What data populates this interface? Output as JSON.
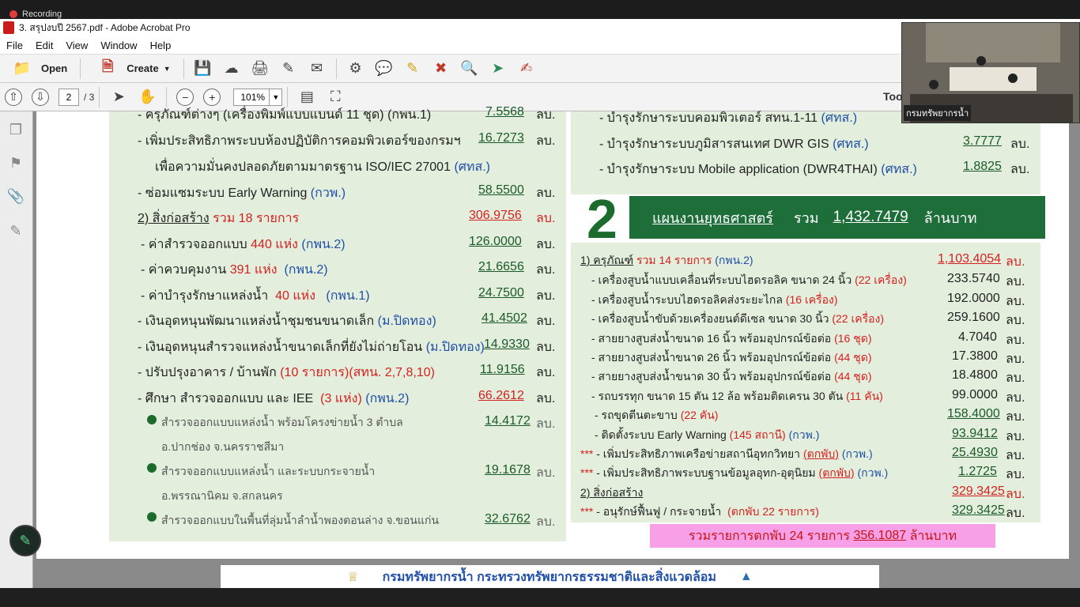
{
  "recording": {
    "label": "Recording"
  },
  "window": {
    "title": "3. สรุปงบปี 2567.pdf - Adobe Acrobat Pro"
  },
  "menu": [
    "File",
    "Edit",
    "View",
    "Window",
    "Help"
  ],
  "toolbar": {
    "open": "Open",
    "create": "Create",
    "tools": "Too"
  },
  "nav": {
    "page": "2",
    "total": "/ 3",
    "zoom": "101%"
  },
  "webcam": {
    "label": "กรมทรัพยากรน้ำ"
  },
  "left": {
    "l0": {
      "text": "- ครุภัณฑ์ต่างๆ (เครื่องพิมพ์แบบแบนด์ 11 ชุด) (กพน.1)",
      "num": "7.5568",
      "unit": "ลบ."
    },
    "l1": {
      "text": "- เพิ่มประสิทธิภาพระบบห้องปฏิบัติการคอมพิวเตอร์ของกรมฯ",
      "num": "16.7273",
      "unit": "ลบ."
    },
    "l1b": {
      "text": "เพื่อความมั่นคงปลอดภัยตามมาตรฐาน ISO/IEC 27001",
      "tag": "(ศทส.)"
    },
    "l2": {
      "text": "- ซ่อมแซมระบบ Early Warning",
      "tag": "(กวพ.)",
      "num": "58.5500",
      "unit": "ลบ."
    },
    "l3": {
      "text": "2) สิ่งก่อสร้าง",
      "red": "รวม 18 รายการ",
      "num": "306.9756",
      "unit": "ลบ."
    },
    "l4": {
      "text": "- ค่าสำรวจออกแบบ",
      "red": "440 แห่ง",
      "tag": "(กพน.2)",
      "num": "126.0000",
      "unit": "ลบ."
    },
    "l5": {
      "text": "- ค่าควบคุมงาน",
      "red": "391 แห่ง",
      "tag": "(กพน.2)",
      "num": "21.6656",
      "unit": "ลบ."
    },
    "l6": {
      "text": "- ค่าบำรุงรักษาแหล่งน้ำ",
      "red": "40 แห่ง",
      "tag": "(กพน.1)",
      "num": "24.7500",
      "unit": "ลบ."
    },
    "l7": {
      "text": "- เงินอุดหนุนพัฒนาแหล่งน้ำชุมชนขนาดเล็ก",
      "tag": "(ม.ปิดทอง)",
      "num": "41.4502",
      "unit": "ลบ."
    },
    "l8": {
      "text": "- เงินอุดหนุนสำรวจแหล่งน้ำขนาดเล็กที่ยังไม่ถ่ายโอน",
      "tag": "(ม.ปิดทอง)",
      "num": "14.9330",
      "unit": "ลบ."
    },
    "l9": {
      "text": "- ปรับปรุงอาคาร / บ้านพัก",
      "red": "(10 รายการ)(สทน. 2,7,8,10)",
      "num": "11.9156",
      "unit": "ลบ."
    },
    "l10": {
      "text": "- ศึกษา สำรวจออกแบบ และ IEE",
      "red": "(3 แห่ง)",
      "tag": "(กพน.2)",
      "num": "66.2612",
      "unit": "ลบ."
    },
    "b1": {
      "text": "สำรวจออกแบบแหล่งน้ำ พร้อมโครงข่ายน้ำ 3 ตำบล",
      "text2": "อ.ปากช่อง จ.นครราชสีมา",
      "num": "14.4172",
      "unit": "ลบ."
    },
    "b2": {
      "text": "สำรวจออกแบบแหล่งน้ำ และระบบกระจายน้ำ",
      "text2": "อ.พรรณานิคม จ.สกลนคร",
      "num": "19.1678",
      "unit": "ลบ."
    },
    "b3": {
      "text": "สำรวจออกแบบในพื้นที่ลุ่มน้ำลำน้ำพองตอนล่าง จ.ขอนแก่น",
      "num": "32.6762",
      "unit": "ลบ."
    }
  },
  "right_top": {
    "r0": {
      "text": "- บำรุงรักษาระบบคอมพิวเตอร์ สทน.1-11",
      "tag": "(ศทส.)"
    },
    "r1": {
      "text": "- บำรุงรักษาระบบภูมิสารสนเทศ DWR GIS",
      "tag": "(ศทส.)",
      "num": "3.7777",
      "unit": "ลบ."
    },
    "r2": {
      "text": "- บำรุงรักษาระบบ Mobile application (DWR4THAI)",
      "tag": "(ศทส.)",
      "num": "1.8825",
      "unit": "ลบ."
    }
  },
  "strategy": {
    "number": "2",
    "title": "แผนงานยุทธศาสตร์",
    "total_label": "รวม",
    "total": "1,432.7479",
    "unit": "ล้านบาท"
  },
  "right": {
    "h1": {
      "text": "1) ครุภัณฑ์",
      "red": "รวม 14 รายการ",
      "tag": "(กพน.2)",
      "num": "1,103.4054",
      "unit": "ลบ."
    },
    "i1": {
      "text": "- เครื่องสูบน้ำแบบเคลื่อนที่ระบบไฮดรอลิค ขนาด 24 นิ้ว",
      "red": "(22 เครื่อง)",
      "num": "233.5740",
      "unit": "ลบ."
    },
    "i2": {
      "text": "- เครื่องสูบน้ำระบบไฮดรอลิคส่งระยะไกล",
      "red": "(16 เครื่อง)",
      "num": "192.0000",
      "unit": "ลบ."
    },
    "i3": {
      "text": "- เครื่องสูบน้ำขับด้วยเครื่องยนต์ดีเซล ขนาด 30 นิ้ว",
      "red": "(22 เครื่อง)",
      "num": "259.1600",
      "unit": "ลบ."
    },
    "i4": {
      "text": "- สายยางสูบส่งน้ำขนาด 16 นิ้ว พร้อมอุปกรณ์ข้อต่อ",
      "red": "(16 ชุด)",
      "num": "4.7040",
      "unit": "ลบ."
    },
    "i5": {
      "text": "- สายยางสูบส่งน้ำขนาด 26 นิ้ว พร้อมอุปกรณ์ข้อต่อ",
      "red": "(44 ชุด)",
      "num": "17.3800",
      "unit": "ลบ."
    },
    "i6": {
      "text": "- สายยางสูบส่งน้ำขนาด 30 นิ้ว พร้อมอุปกรณ์ข้อต่อ",
      "red": "(44 ชุด)",
      "num": "18.4800",
      "unit": "ลบ."
    },
    "i7": {
      "text": "- รถบรรทุก ขนาด 15 ตัน 12 ล้อ พร้อมติดเครน 30 ตัน",
      "red": "(11 คัน)",
      "num": "99.0000",
      "unit": "ลบ."
    },
    "i8": {
      "text": "- รถขุดตีนตะขาบ",
      "red": "(22 คัน)",
      "num": "158.4000",
      "unit": "ลบ."
    },
    "i9": {
      "text": "- ติดตั้งระบบ Early Warning",
      "red": "(145 สถานี)",
      "tag": "(กวพ.)",
      "num": "93.9412",
      "unit": "ลบ."
    },
    "i10": {
      "stars": "***",
      "text": "- เพิ่มประสิทธิภาพเครือข่ายสถานีอุทกวิทยา",
      "red": "(ตกพับ)",
      "tag": "(กวพ.)",
      "num": "25.4930",
      "unit": "ลบ."
    },
    "i11": {
      "stars": "***",
      "text": "- เพิ่มประสิทธิภาพระบบฐานข้อมูลอุทก-อุตุนิยม",
      "red": "(ตกพับ)",
      "tag": "(กวพ.)",
      "num": "1.2725",
      "unit": "ลบ."
    },
    "h2": {
      "text": "2) สิ่งก่อสร้าง",
      "num": "329.3425",
      "unit": "ลบ."
    },
    "i12": {
      "stars": "***",
      "text": "- อนุรักษ์ฟื้นฟู / กระจายน้ำ",
      "red": "(ตกพับ 22 รายการ)",
      "num": "329.3425",
      "unit": "ลบ."
    }
  },
  "summary": {
    "prefix": "รวมรายการตกพับ 24 รายการ",
    "amount": "356.1087",
    "suffix": "ล้านบาท"
  },
  "footer": {
    "text": "กรมทรัพยากรน้ำ กระทรวงทรัพยากรธรรมชาติและสิ่งแวดล้อม"
  }
}
